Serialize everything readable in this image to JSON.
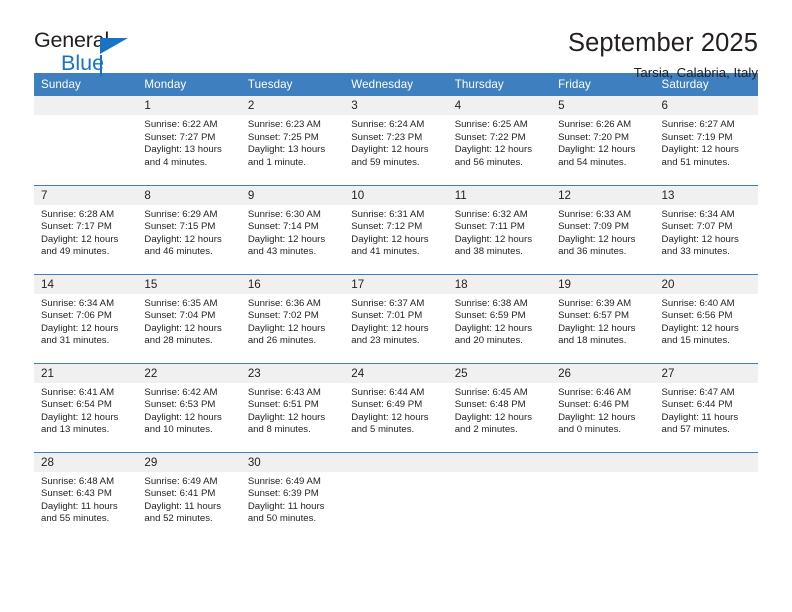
{
  "brand": {
    "name_top": "General",
    "name_bottom": "Blue",
    "accent_color": "#1773c4"
  },
  "header": {
    "title": "September 2025",
    "subtitle": "Tarsia, Calabria, Italy"
  },
  "theme": {
    "header_bg": "#3d7fbf",
    "header_text": "#ffffff",
    "daynum_bg": "#f0f0f0",
    "cell_bg": "#ffffff",
    "text": "#231f20"
  },
  "labels": {
    "sunrise_prefix": "Sunrise:",
    "sunset_prefix": "Sunset:",
    "daylight_prefix": "Daylight:"
  },
  "weekday_headers": [
    "Sunday",
    "Monday",
    "Tuesday",
    "Wednesday",
    "Thursday",
    "Friday",
    "Saturday"
  ],
  "weeks": [
    [
      {
        "day": "",
        "sunrise": "",
        "sunset": "",
        "daylight": ""
      },
      {
        "day": "1",
        "sunrise": "Sunrise: 6:22 AM",
        "sunset": "Sunset: 7:27 PM",
        "daylight": "Daylight: 13 hours and 4 minutes."
      },
      {
        "day": "2",
        "sunrise": "Sunrise: 6:23 AM",
        "sunset": "Sunset: 7:25 PM",
        "daylight": "Daylight: 13 hours and 1 minute."
      },
      {
        "day": "3",
        "sunrise": "Sunrise: 6:24 AM",
        "sunset": "Sunset: 7:23 PM",
        "daylight": "Daylight: 12 hours and 59 minutes."
      },
      {
        "day": "4",
        "sunrise": "Sunrise: 6:25 AM",
        "sunset": "Sunset: 7:22 PM",
        "daylight": "Daylight: 12 hours and 56 minutes."
      },
      {
        "day": "5",
        "sunrise": "Sunrise: 6:26 AM",
        "sunset": "Sunset: 7:20 PM",
        "daylight": "Daylight: 12 hours and 54 minutes."
      },
      {
        "day": "6",
        "sunrise": "Sunrise: 6:27 AM",
        "sunset": "Sunset: 7:19 PM",
        "daylight": "Daylight: 12 hours and 51 minutes."
      }
    ],
    [
      {
        "day": "7",
        "sunrise": "Sunrise: 6:28 AM",
        "sunset": "Sunset: 7:17 PM",
        "daylight": "Daylight: 12 hours and 49 minutes."
      },
      {
        "day": "8",
        "sunrise": "Sunrise: 6:29 AM",
        "sunset": "Sunset: 7:15 PM",
        "daylight": "Daylight: 12 hours and 46 minutes."
      },
      {
        "day": "9",
        "sunrise": "Sunrise: 6:30 AM",
        "sunset": "Sunset: 7:14 PM",
        "daylight": "Daylight: 12 hours and 43 minutes."
      },
      {
        "day": "10",
        "sunrise": "Sunrise: 6:31 AM",
        "sunset": "Sunset: 7:12 PM",
        "daylight": "Daylight: 12 hours and 41 minutes."
      },
      {
        "day": "11",
        "sunrise": "Sunrise: 6:32 AM",
        "sunset": "Sunset: 7:11 PM",
        "daylight": "Daylight: 12 hours and 38 minutes."
      },
      {
        "day": "12",
        "sunrise": "Sunrise: 6:33 AM",
        "sunset": "Sunset: 7:09 PM",
        "daylight": "Daylight: 12 hours and 36 minutes."
      },
      {
        "day": "13",
        "sunrise": "Sunrise: 6:34 AM",
        "sunset": "Sunset: 7:07 PM",
        "daylight": "Daylight: 12 hours and 33 minutes."
      }
    ],
    [
      {
        "day": "14",
        "sunrise": "Sunrise: 6:34 AM",
        "sunset": "Sunset: 7:06 PM",
        "daylight": "Daylight: 12 hours and 31 minutes."
      },
      {
        "day": "15",
        "sunrise": "Sunrise: 6:35 AM",
        "sunset": "Sunset: 7:04 PM",
        "daylight": "Daylight: 12 hours and 28 minutes."
      },
      {
        "day": "16",
        "sunrise": "Sunrise: 6:36 AM",
        "sunset": "Sunset: 7:02 PM",
        "daylight": "Daylight: 12 hours and 26 minutes."
      },
      {
        "day": "17",
        "sunrise": "Sunrise: 6:37 AM",
        "sunset": "Sunset: 7:01 PM",
        "daylight": "Daylight: 12 hours and 23 minutes."
      },
      {
        "day": "18",
        "sunrise": "Sunrise: 6:38 AM",
        "sunset": "Sunset: 6:59 PM",
        "daylight": "Daylight: 12 hours and 20 minutes."
      },
      {
        "day": "19",
        "sunrise": "Sunrise: 6:39 AM",
        "sunset": "Sunset: 6:57 PM",
        "daylight": "Daylight: 12 hours and 18 minutes."
      },
      {
        "day": "20",
        "sunrise": "Sunrise: 6:40 AM",
        "sunset": "Sunset: 6:56 PM",
        "daylight": "Daylight: 12 hours and 15 minutes."
      }
    ],
    [
      {
        "day": "21",
        "sunrise": "Sunrise: 6:41 AM",
        "sunset": "Sunset: 6:54 PM",
        "daylight": "Daylight: 12 hours and 13 minutes."
      },
      {
        "day": "22",
        "sunrise": "Sunrise: 6:42 AM",
        "sunset": "Sunset: 6:53 PM",
        "daylight": "Daylight: 12 hours and 10 minutes."
      },
      {
        "day": "23",
        "sunrise": "Sunrise: 6:43 AM",
        "sunset": "Sunset: 6:51 PM",
        "daylight": "Daylight: 12 hours and 8 minutes."
      },
      {
        "day": "24",
        "sunrise": "Sunrise: 6:44 AM",
        "sunset": "Sunset: 6:49 PM",
        "daylight": "Daylight: 12 hours and 5 minutes."
      },
      {
        "day": "25",
        "sunrise": "Sunrise: 6:45 AM",
        "sunset": "Sunset: 6:48 PM",
        "daylight": "Daylight: 12 hours and 2 minutes."
      },
      {
        "day": "26",
        "sunrise": "Sunrise: 6:46 AM",
        "sunset": "Sunset: 6:46 PM",
        "daylight": "Daylight: 12 hours and 0 minutes."
      },
      {
        "day": "27",
        "sunrise": "Sunrise: 6:47 AM",
        "sunset": "Sunset: 6:44 PM",
        "daylight": "Daylight: 11 hours and 57 minutes."
      }
    ],
    [
      {
        "day": "28",
        "sunrise": "Sunrise: 6:48 AM",
        "sunset": "Sunset: 6:43 PM",
        "daylight": "Daylight: 11 hours and 55 minutes."
      },
      {
        "day": "29",
        "sunrise": "Sunrise: 6:49 AM",
        "sunset": "Sunset: 6:41 PM",
        "daylight": "Daylight: 11 hours and 52 minutes."
      },
      {
        "day": "30",
        "sunrise": "Sunrise: 6:49 AM",
        "sunset": "Sunset: 6:39 PM",
        "daylight": "Daylight: 11 hours and 50 minutes."
      },
      {
        "day": "",
        "sunrise": "",
        "sunset": "",
        "daylight": ""
      },
      {
        "day": "",
        "sunrise": "",
        "sunset": "",
        "daylight": ""
      },
      {
        "day": "",
        "sunrise": "",
        "sunset": "",
        "daylight": ""
      },
      {
        "day": "",
        "sunrise": "",
        "sunset": "",
        "daylight": ""
      }
    ]
  ]
}
